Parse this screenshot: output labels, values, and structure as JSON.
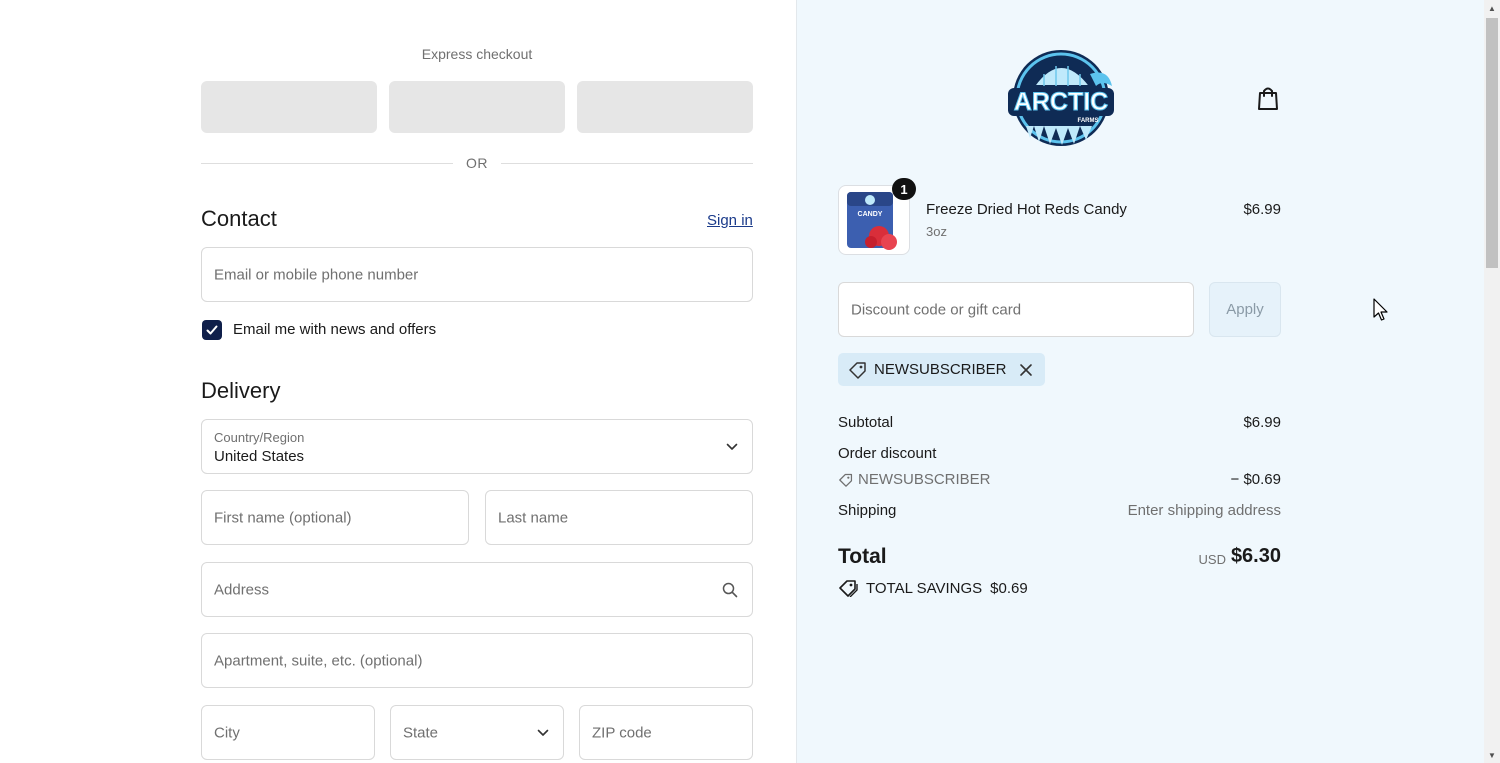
{
  "express": {
    "label": "Express checkout",
    "or_text": "OR"
  },
  "contact": {
    "title": "Contact",
    "sign_in": "Sign in",
    "email_placeholder": "Email or mobile phone number",
    "newsletter_label": "Email me with news and offers",
    "newsletter_checked": true
  },
  "delivery": {
    "title": "Delivery",
    "country_label": "Country/Region",
    "country_value": "United States",
    "first_name_placeholder": "First name (optional)",
    "last_name_placeholder": "Last name",
    "address_placeholder": "Address",
    "apartment_placeholder": "Apartment, suite, etc. (optional)",
    "city_placeholder": "City",
    "state_placeholder": "State",
    "zip_placeholder": "ZIP code"
  },
  "store": {
    "logo_text": "ARCTIC",
    "logo_subtext": "FARMS",
    "cart_icon": "shopping-bag-icon"
  },
  "cart": {
    "items": [
      {
        "name": "Freeze Dried Hot Reds Candy",
        "variant": "3oz",
        "price": "$6.99",
        "quantity": "1",
        "image_label": "CANDY"
      }
    ]
  },
  "discount": {
    "placeholder": "Discount code or gift card",
    "apply_label": "Apply",
    "applied_code": "NEWSUBSCRIBER"
  },
  "summary": {
    "subtotal_label": "Subtotal",
    "subtotal_value": "$6.99",
    "order_discount_label": "Order discount",
    "discount_code": "NEWSUBSCRIBER",
    "discount_value": "− $0.69",
    "shipping_label": "Shipping",
    "shipping_value": "Enter shipping address",
    "total_label": "Total",
    "currency": "USD",
    "total_value": "$6.30",
    "savings_label": "TOTAL SAVINGS",
    "savings_value": "$0.69"
  },
  "colors": {
    "accent": "#0f1f4a",
    "summary_bg": "#f0f8fd",
    "chip_bg": "#d8ebf7",
    "link": "#1a3a8a"
  }
}
